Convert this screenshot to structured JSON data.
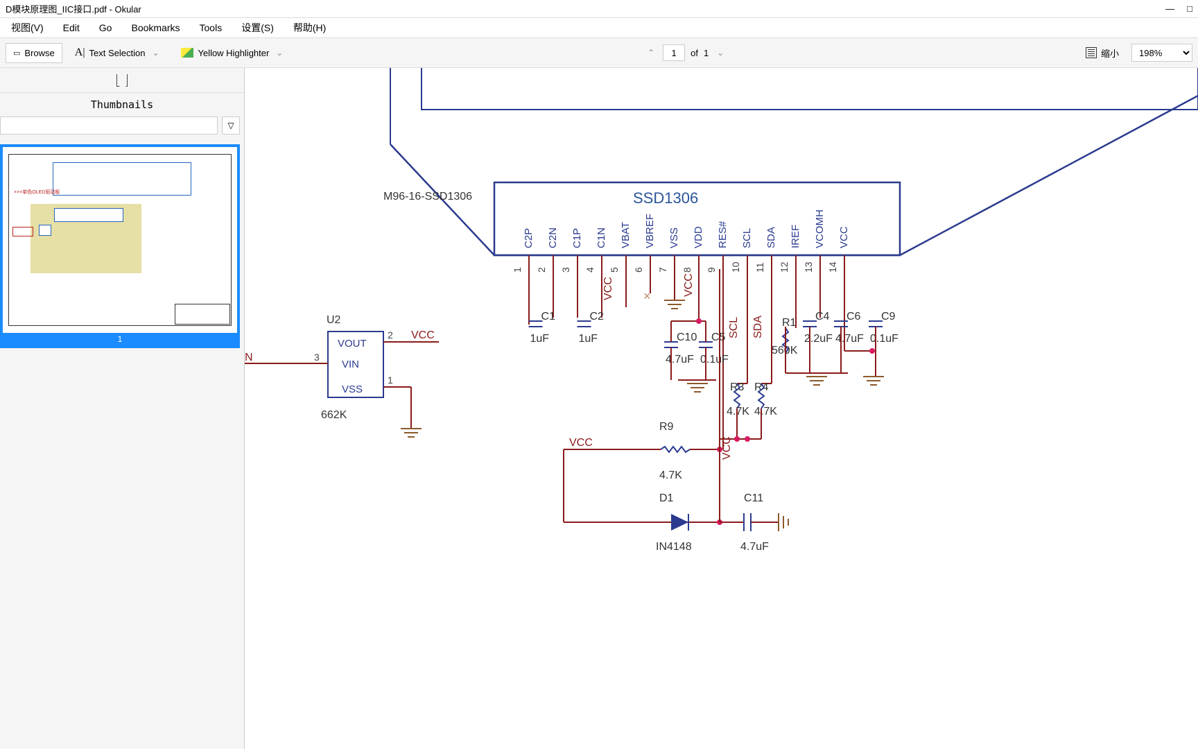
{
  "window": {
    "title": "D模块原理图_IIC接口.pdf - Okular",
    "minimize": "—",
    "maximize": "□"
  },
  "menu": {
    "view": "视图(V)",
    "edit": "Edit",
    "go": "Go",
    "bookmarks": "Bookmarks",
    "tools": "Tools",
    "settings": "设置(S)",
    "help": "帮助(H)"
  },
  "toolbar": {
    "browse": "Browse",
    "text_selection": "Text Selection",
    "yellow_highlighter": "Yellow Highlighter",
    "zoom_label": "缩小",
    "zoom_value": "198%"
  },
  "nav": {
    "page_current": "1",
    "of": "of",
    "page_total": "1"
  },
  "sidebar": {
    "title": "Thumbnails",
    "page_num": "1"
  },
  "schematic": {
    "module_label": "M96-16-SSD1306",
    "chip_name": "SSD1306",
    "u2_ref": "U2",
    "u2_vout": "VOUT",
    "u2_vin": "VIN",
    "u2_vss": "VSS",
    "u2_val": "662K",
    "u2_pin1": "1",
    "u2_pin2": "2",
    "u2_pin3": "3",
    "u2_net_n": "N",
    "vcc": "VCC",
    "pins": [
      {
        "num": "1",
        "name": "C2P"
      },
      {
        "num": "2",
        "name": "C2N"
      },
      {
        "num": "3",
        "name": "C1P"
      },
      {
        "num": "4",
        "name": "C1N"
      },
      {
        "num": "5",
        "name": "VBAT"
      },
      {
        "num": "6",
        "name": "VBREF"
      },
      {
        "num": "7",
        "name": "VSS"
      },
      {
        "num": "8",
        "name": "VDD"
      },
      {
        "num": "9",
        "name": "RES#"
      },
      {
        "num": "10",
        "name": "SCL"
      },
      {
        "num": "11",
        "name": "SDA"
      },
      {
        "num": "12",
        "name": "IREF"
      },
      {
        "num": "13",
        "name": "VCOMH"
      },
      {
        "num": "14",
        "name": "VCC"
      }
    ],
    "c1_ref": "C1",
    "c1_val": "1uF",
    "c2_ref": "C2",
    "c2_val": "1uF",
    "c10_ref": "C10",
    "c10_val": "4.7uF",
    "c5_ref": "C5",
    "c5_val": "0.1uF",
    "c4_ref": "C4",
    "c4_val": "2.2uF",
    "c6_ref": "C6",
    "c6_val": "4.7uF",
    "c9_ref": "C9",
    "c9_val": "0.1uF",
    "c11_ref": "C11",
    "c11_val": "4.7uF",
    "r1_ref": "R1",
    "r1_val": "560K",
    "r3_ref": "R3",
    "r3_val": "4.7K",
    "r4_ref": "R4",
    "r4_val": "4.7K",
    "r9_ref": "R9",
    "r9_val": "4.7K",
    "d1_ref": "D1",
    "d1_val": "IN4148",
    "scl": "SCL",
    "sda": "SDA"
  }
}
